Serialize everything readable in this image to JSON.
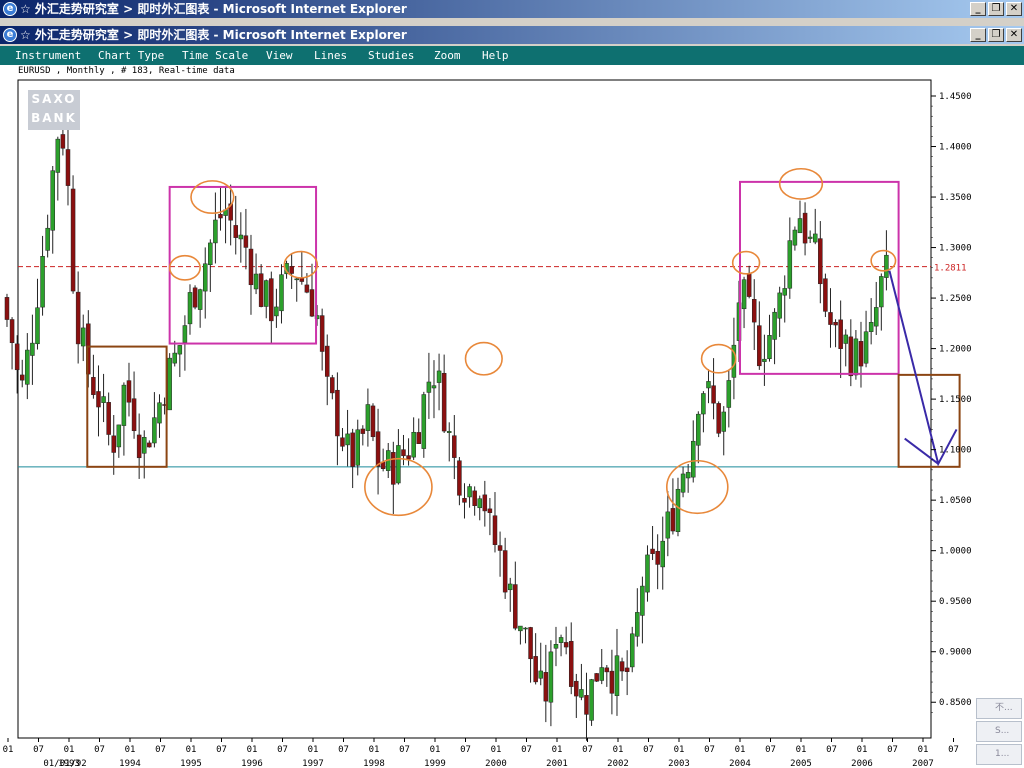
{
  "window_titles": [
    "☆ 外汇走势研究室 > 即时外汇图表 - Microsoft Internet Explorer",
    "☆ 外汇走势研究室 > 即时外汇图表 - Microsoft Internet Explorer"
  ],
  "window_buttons": {
    "minimize": "_",
    "restore": "❐",
    "close": "✕"
  },
  "menu": [
    "Instrument",
    "Chart Type",
    "Time Scale",
    "View",
    "Lines",
    "Studies",
    "Zoom",
    "Help"
  ],
  "chart_info": "EURUSD , Monthly , # 183, Real-time data",
  "logo": {
    "line1": "SAXO",
    "line2": "BANK"
  },
  "side_items": [
    "不...",
    "S...",
    "1..."
  ],
  "colors": {
    "up": "#2ca02c",
    "down": "#8b1010",
    "resistance_line": "#cc2222",
    "support_line": "#1a8a9a",
    "box_magenta": "#cc33aa",
    "box_brown": "#8b4513",
    "circle": "#e8883a",
    "arrow": "#3a2aa8"
  },
  "chart_data": {
    "type": "candlestick",
    "instrument": "EURUSD",
    "period": "Monthly",
    "ylim": [
      0.82,
      1.47
    ],
    "yticks": [
      "1.4500",
      "1.4000",
      "1.3500",
      "1.3000",
      "1.2500",
      "1.2000",
      "1.1500",
      "1.1000",
      "1.0500",
      "1.0000",
      "0.9500",
      "0.9000",
      "0.8500"
    ],
    "resistance_label": "1.2811",
    "resistance_level": 1.2811,
    "support_level": 1.083,
    "xaxis_month_labels": [
      "01",
      "07",
      "01",
      "07",
      "01",
      "07",
      "01",
      "07",
      "01",
      "07",
      "01",
      "07",
      "01",
      "07",
      "01",
      "07",
      "01",
      "07",
      "01",
      "07",
      "01",
      "07",
      "01",
      "07",
      "01",
      "07",
      "01",
      "07",
      "01",
      "07",
      "01",
      "07"
    ],
    "xaxis_year_labels": [
      "01/01/92",
      "1993",
      "1994",
      "1995",
      "1996",
      "1997",
      "1998",
      "1999",
      "2000",
      "2001",
      "2002",
      "2003",
      "2004",
      "2005",
      "2006",
      "2007"
    ],
    "waypoints": [
      [
        1991.9,
        1.25
      ],
      [
        1992.1,
        1.2
      ],
      [
        1992.2,
        1.15
      ],
      [
        1992.4,
        1.22
      ],
      [
        1992.6,
        1.31
      ],
      [
        1992.85,
        1.43
      ],
      [
        1992.95,
        1.39
      ],
      [
        1993.1,
        1.24
      ],
      [
        1993.3,
        1.18
      ],
      [
        1993.5,
        1.15
      ],
      [
        1993.7,
        1.1
      ],
      [
        1993.9,
        1.16
      ],
      [
        1994.05,
        1.14
      ],
      [
        1994.2,
        1.1
      ],
      [
        1994.4,
        1.13
      ],
      [
        1994.6,
        1.17
      ],
      [
        1994.8,
        1.2
      ],
      [
        1995.0,
        1.25
      ],
      [
        1995.2,
        1.28
      ],
      [
        1995.4,
        1.32
      ],
      [
        1995.55,
        1.34
      ],
      [
        1995.75,
        1.31
      ],
      [
        1995.9,
        1.3
      ],
      [
        1996.1,
        1.26
      ],
      [
        1996.3,
        1.24
      ],
      [
        1996.5,
        1.26
      ],
      [
        1996.7,
        1.28
      ],
      [
        1996.9,
        1.26
      ],
      [
        1997.05,
        1.24
      ],
      [
        1997.2,
        1.16
      ],
      [
        1997.4,
        1.13
      ],
      [
        1997.6,
        1.09
      ],
      [
        1997.75,
        1.1
      ],
      [
        1997.9,
        1.13
      ],
      [
        1998.05,
        1.09
      ],
      [
        1998.2,
        1.08
      ],
      [
        1998.4,
        1.09
      ],
      [
        1998.55,
        1.1
      ],
      [
        1998.7,
        1.12
      ],
      [
        1998.9,
        1.17
      ],
      [
        1999.0,
        1.18
      ],
      [
        1999.15,
        1.14
      ],
      [
        1999.3,
        1.09
      ],
      [
        1999.45,
        1.07
      ],
      [
        1999.6,
        1.06
      ],
      [
        1999.75,
        1.07
      ],
      [
        1999.9,
        1.02
      ],
      [
        2000.1,
        0.99
      ],
      [
        2000.25,
        0.95
      ],
      [
        2000.4,
        0.93
      ],
      [
        2000.55,
        0.9
      ],
      [
        2000.7,
        0.86
      ],
      [
        2000.85,
        0.86
      ],
      [
        2001.0,
        0.93
      ],
      [
        2001.15,
        0.91
      ],
      [
        2001.3,
        0.87
      ],
      [
        2001.45,
        0.85
      ],
      [
        2001.6,
        0.87
      ],
      [
        2001.75,
        0.9
      ],
      [
        2001.9,
        0.88
      ],
      [
        2002.1,
        0.87
      ],
      [
        2002.25,
        0.9
      ],
      [
        2002.4,
        0.97
      ],
      [
        2002.55,
        0.98
      ],
      [
        2002.7,
        1.0
      ],
      [
        2002.9,
        1.04
      ],
      [
        2003.05,
        1.08
      ],
      [
        2003.2,
        1.1
      ],
      [
        2003.35,
        1.17
      ],
      [
        2003.5,
        1.15
      ],
      [
        2003.7,
        1.12
      ],
      [
        2003.85,
        1.17
      ],
      [
        2004.0,
        1.26
      ],
      [
        2004.15,
        1.23
      ],
      [
        2004.3,
        1.2
      ],
      [
        2004.45,
        1.21
      ],
      [
        2004.6,
        1.23
      ],
      [
        2004.8,
        1.3
      ],
      [
        2004.95,
        1.34
      ],
      [
        2005.1,
        1.31
      ],
      [
        2005.25,
        1.29
      ],
      [
        2005.4,
        1.24
      ],
      [
        2005.55,
        1.21
      ],
      [
        2005.7,
        1.21
      ],
      [
        2005.85,
        1.19
      ],
      [
        2006.0,
        1.2
      ],
      [
        2006.15,
        1.21
      ],
      [
        2006.3,
        1.26
      ],
      [
        2006.45,
        1.28
      ]
    ],
    "annotations": {
      "boxes": [
        {
          "x0": 1993.3,
          "x1": 1994.6,
          "y0": 1.083,
          "y1": 1.202,
          "style": "brown"
        },
        {
          "x0": 1994.65,
          "x1": 1997.05,
          "y0": 1.205,
          "y1": 1.36,
          "style": "magenta"
        },
        {
          "x0": 2004.0,
          "x1": 2006.6,
          "y0": 1.175,
          "y1": 1.365,
          "style": "magenta"
        },
        {
          "x0": 2006.6,
          "x1": 2007.6,
          "y0": 1.083,
          "y1": 1.174,
          "style": "brown"
        }
      ],
      "circles": [
        {
          "x": 1994.9,
          "y": 1.28,
          "rx": 0.25,
          "ry": 0.012
        },
        {
          "x": 1995.35,
          "y": 1.35,
          "rx": 0.35,
          "ry": 0.016
        },
        {
          "x": 1996.8,
          "y": 1.283,
          "rx": 0.27,
          "ry": 0.013
        },
        {
          "x": 1998.4,
          "y": 1.063,
          "rx": 0.55,
          "ry": 0.028
        },
        {
          "x": 1999.8,
          "y": 1.19,
          "rx": 0.3,
          "ry": 0.016
        },
        {
          "x": 2003.3,
          "y": 1.063,
          "rx": 0.5,
          "ry": 0.026
        },
        {
          "x": 2003.65,
          "y": 1.19,
          "rx": 0.28,
          "ry": 0.014
        },
        {
          "x": 2004.1,
          "y": 1.285,
          "rx": 0.22,
          "ry": 0.011
        },
        {
          "x": 2005.0,
          "y": 1.363,
          "rx": 0.35,
          "ry": 0.015
        },
        {
          "x": 2006.35,
          "y": 1.287,
          "rx": 0.2,
          "ry": 0.01
        }
      ],
      "arrow_path": [
        [
          2006.45,
          1.277
        ],
        [
          2007.25,
          1.086
        ],
        [
          2007.55,
          1.12
        ]
      ],
      "arrow_branch": [
        [
          2006.7,
          1.111
        ],
        [
          2007.25,
          1.086
        ]
      ]
    }
  }
}
